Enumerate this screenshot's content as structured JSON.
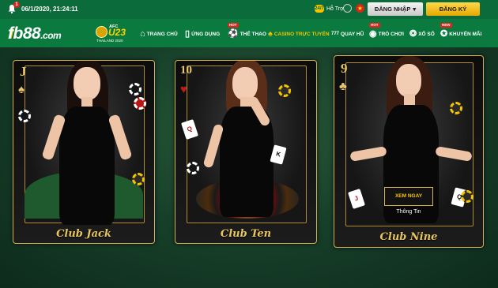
{
  "topbar": {
    "notification_count": "1",
    "datetime": "06/1/2020, 21:24:11",
    "support_label": "Hỗ Trợ",
    "support_icon": "24/7",
    "login_label": "ĐĂNG NHẬP",
    "register_label": "ĐĂNG KÝ",
    "flag_symbol": "★"
  },
  "logo": {
    "text": "fb88",
    "suffix": ".com",
    "badge_afc": "AFC",
    "badge_u23": "U23",
    "badge_sub": "THAILAND 2020"
  },
  "nav": [
    {
      "label": "TRANG CHỦ",
      "icon": "home-icon",
      "glyph": "⌂",
      "hot": false,
      "active": false
    },
    {
      "label": "ỨNG DỤNG",
      "icon": "phone-icon",
      "glyph": "▯",
      "hot": false,
      "active": false
    },
    {
      "label": "THỂ THAO",
      "icon": "soccer-ball-icon",
      "glyph": "⚽",
      "hot": true,
      "hot_label": "HOT",
      "active": false
    },
    {
      "label": "CASINO TRỰC TUYẾN",
      "icon": "cards-icon",
      "glyph": "♠",
      "hot": false,
      "active": true
    },
    {
      "label": "QUAY HŨ",
      "icon": "slot-machine-icon",
      "glyph": "777",
      "hot": false,
      "active": false
    },
    {
      "label": "TRÒ CHƠI",
      "icon": "gamepad-icon",
      "glyph": "◉",
      "hot": true,
      "hot_label": "HOT",
      "active": false
    },
    {
      "label": "XỔ SỐ",
      "icon": "lottery-icon",
      "glyph": "❂",
      "hot": false,
      "active": false
    },
    {
      "label": "KHUYẾN MÃI",
      "icon": "gift-icon",
      "glyph": "✪",
      "hot": true,
      "hot_label": "NEW",
      "active": false
    }
  ],
  "cards": [
    {
      "rank": "J",
      "suit": "♠",
      "suit_color": "gold",
      "title": "Club Jack"
    },
    {
      "rank": "10",
      "suit": "♥",
      "suit_color": "red",
      "title": "Club Ten"
    },
    {
      "rank": "9",
      "suit": "♣",
      "suit_color": "gold",
      "title": "Club Nine"
    }
  ],
  "hover_card": {
    "cta_label": "XEM NGAY",
    "info_label": "Thông Tin"
  },
  "colors": {
    "topbar": "#0b6b3a",
    "navbar": "#0a7a3e",
    "accent_gold": "#f5c400",
    "card_border": "#d6b24c"
  }
}
